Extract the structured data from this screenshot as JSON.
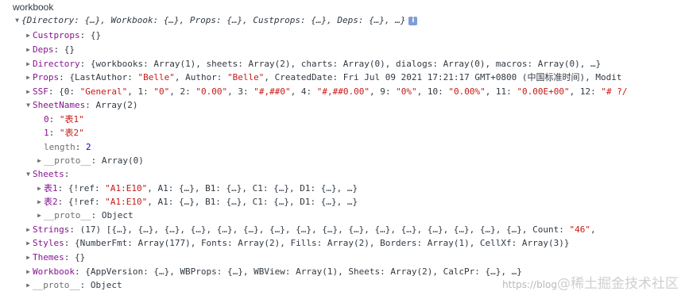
{
  "title": "workbook",
  "root": "{Directory: {…}, Workbook: {…}, Props: {…}, Custprops: {…}, Deps: {…}, …}",
  "info_icon": "info-icon",
  "custprops": {
    "key": "Custprops",
    "sep": ":",
    "val": " {}"
  },
  "deps": {
    "key": "Deps",
    "sep": ":",
    "val": " {}"
  },
  "directory": {
    "key": "Directory",
    "sep": ":",
    "pre": " {workbooks: Array(1), sheets: Array(2), charts: Array(0), dialogs: Array(0), macros: Array(0), …}"
  },
  "props": {
    "key": "Props",
    "sep": ":",
    "p1": " {LastAuthor: ",
    "s1": "\"Belle\"",
    "p2": ", Author: ",
    "s2": "\"Belle\"",
    "p3": ", CreatedDate: Fri Jul 09 2021 17:21:17 GMT+0800 (中国标准时间), Modit"
  },
  "ssf": {
    "key": "SSF",
    "sep": ":",
    "p0": " {0: ",
    "s0": "\"General\"",
    "p1": ", 1: ",
    "s1": "\"0\"",
    "p2": ", 2: ",
    "s2": "\"0.00\"",
    "p3": ", 3: ",
    "s3": "\"#,##0\"",
    "p4": ", 4: ",
    "s4": "\"#,##0.00\"",
    "p9": ", 9: ",
    "s9": "\"0%\"",
    "p10": ", 10: ",
    "s10": "\"0.00%\"",
    "p11": ", 11: ",
    "s11": "\"0.00E+00\"",
    "p12": ", 12: ",
    "s12": "\"# ?/"
  },
  "sheetnames": {
    "key": "SheetNames",
    "sep": ":",
    "val": " Array(2)",
    "i0k": "0",
    "i0v": "\"表1\"",
    "i1k": "1",
    "i1v": "\"表2\"",
    "lenk": "length",
    "lenv": "2",
    "protok": "__proto__",
    "protov": " Array(0)"
  },
  "sheets": {
    "key": "Sheets",
    "sep": ":",
    "s1k": "表1",
    "s1a": " {!ref: ",
    "s1r": "\"A1:E10\"",
    "s1b": ", A1: {…}, B1: {…}, C1: {…}, D1: {…}, …}",
    "s2k": "表2",
    "s2a": " {!ref: ",
    "s2r": "\"A1:E10\"",
    "s2b": ", A1: {…}, B1: {…}, C1: {…}, D1: {…}, …}",
    "protok": "__proto__",
    "protov": " Object"
  },
  "strings": {
    "key": "Strings",
    "sep": ":",
    "pre": " (17) [{…}, {…}, {…}, {…}, {…}, {…}, {…}, {…}, {…}, {…}, {…}, {…}, {…}, {…}, {…}, {…}, Count: ",
    "cnt": "\"46\"",
    "post": ", "
  },
  "styles": {
    "key": "Styles",
    "sep": ":",
    "val": " {NumberFmt: Array(177), Fonts: Array(2), Fills: Array(2), Borders: Array(1), CellXf: Array(3)}"
  },
  "themes": {
    "key": "Themes",
    "sep": ":",
    "val": " {}"
  },
  "workbook": {
    "key": "Workbook",
    "sep": ":",
    "val": " {AppVersion: {…}, WBProps: {…}, WBView: Array(1), Sheets: Array(2), CalcPr: {…}, …}"
  },
  "proto": {
    "key": "__proto__",
    "sep": ":",
    "val": " Object"
  },
  "watermark": {
    "small": "https://blog",
    "big": "@稀土掘金技术社区"
  }
}
